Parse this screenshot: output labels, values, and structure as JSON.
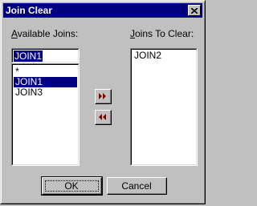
{
  "window": {
    "title": "Join Clear"
  },
  "available": {
    "label": "Available Joins:",
    "input_value": "JOIN1",
    "items": [
      "*",
      "JOIN1",
      "JOIN3"
    ],
    "selected_index": 1
  },
  "to_clear": {
    "label": "Joins To Clear:",
    "items": [
      "JOIN2"
    ]
  },
  "buttons": {
    "ok": "OK",
    "cancel": "Cancel",
    "add_icon": "double-chevron-right-icon",
    "remove_icon": "double-chevron-left-icon"
  },
  "colors": {
    "title_bar": "#000080",
    "selection": "#000080",
    "arrow": "#800000",
    "face": "#c0c0c0"
  }
}
